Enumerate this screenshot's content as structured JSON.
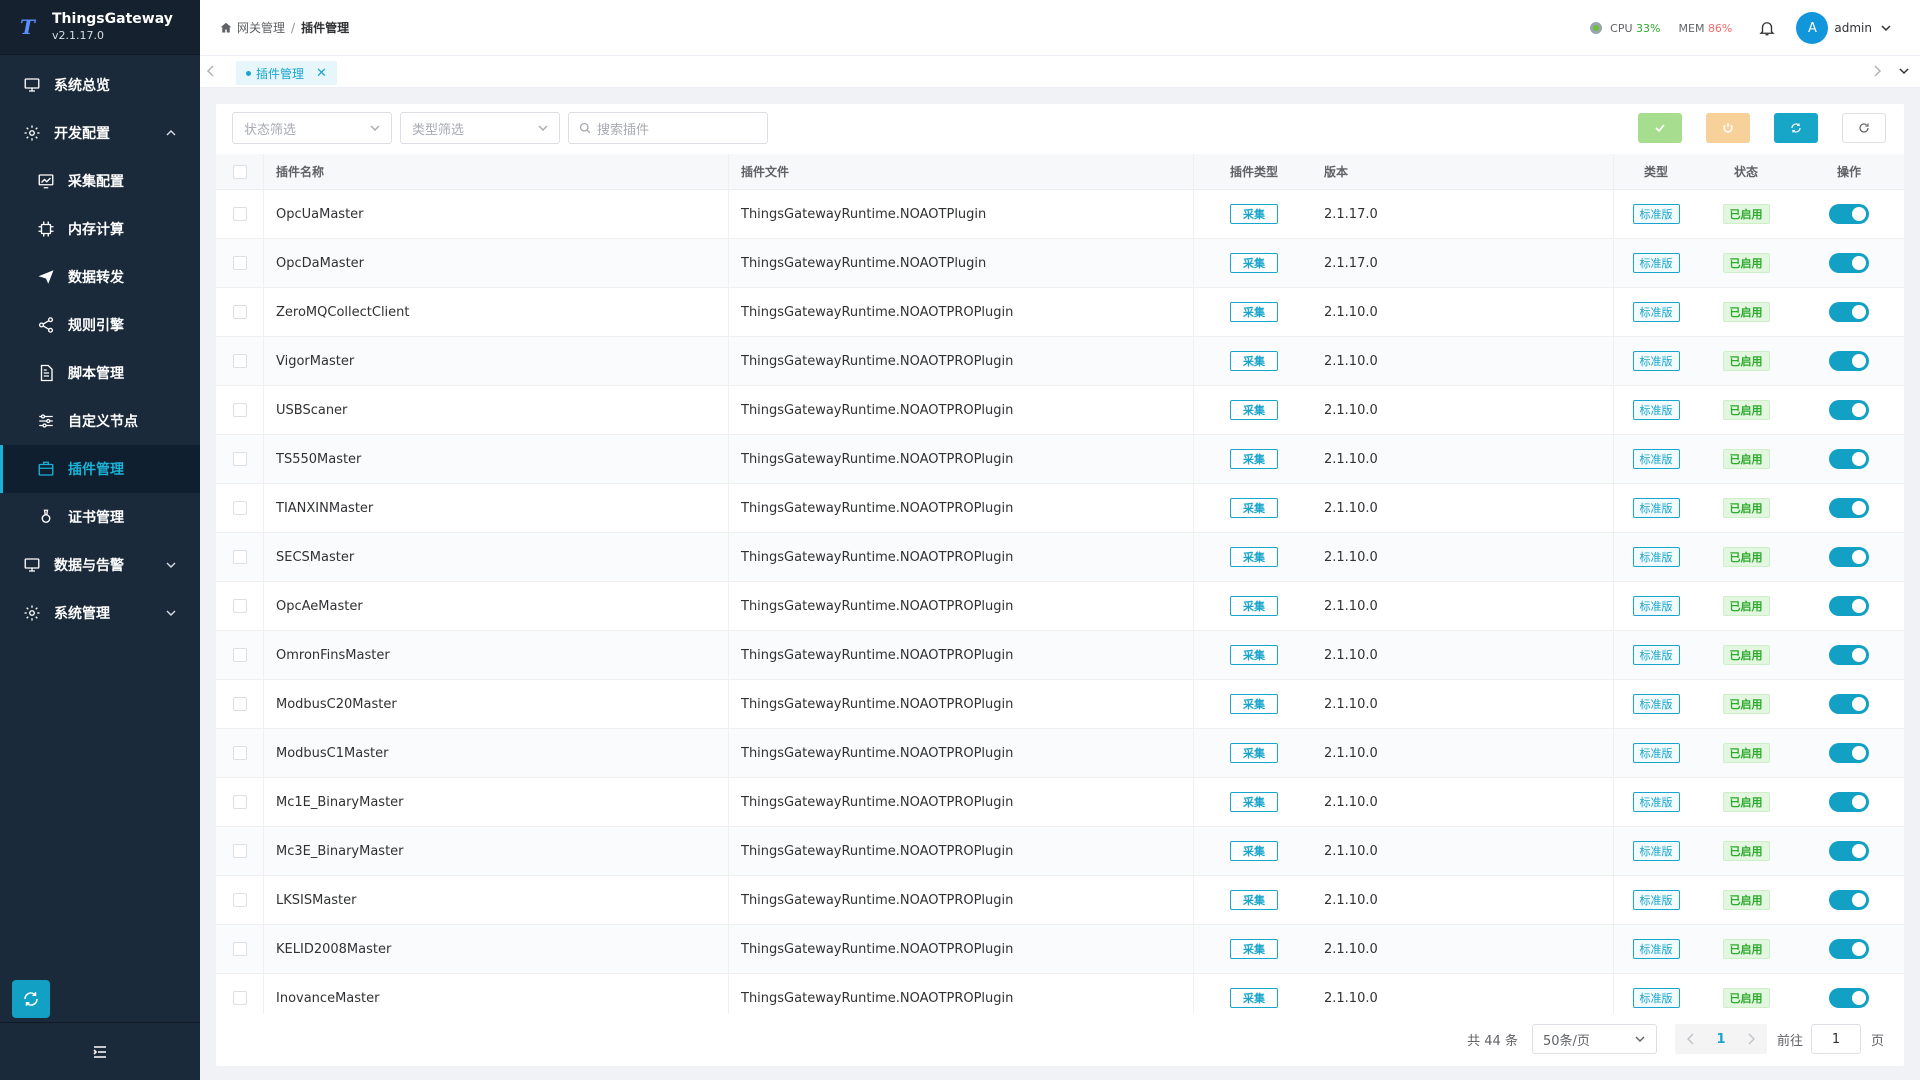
{
  "app": {
    "name": "ThingsGateway",
    "version": "v2.1.17.0",
    "logo": "T"
  },
  "sidebar": {
    "items": [
      {
        "label": "系统总览",
        "icon": "monitor-icon",
        "level": "top"
      },
      {
        "label": "开发配置",
        "icon": "gear-icon",
        "level": "top",
        "expanded": true
      },
      {
        "label": "采集配置",
        "icon": "chart-monitor-icon",
        "level": "sub"
      },
      {
        "label": "内存计算",
        "icon": "chip-icon",
        "level": "sub"
      },
      {
        "label": "数据转发",
        "icon": "send-icon",
        "level": "sub"
      },
      {
        "label": "规则引擎",
        "icon": "share-icon",
        "level": "sub"
      },
      {
        "label": "脚本管理",
        "icon": "document-icon",
        "level": "sub"
      },
      {
        "label": "自定义节点",
        "icon": "sliders-icon",
        "level": "sub"
      },
      {
        "label": "插件管理",
        "icon": "plugin-icon",
        "level": "sub",
        "active": true
      },
      {
        "label": "证书管理",
        "icon": "certificate-icon",
        "level": "sub"
      },
      {
        "label": "数据与告警",
        "icon": "monitor-icon",
        "level": "top",
        "expanded": false
      },
      {
        "label": "系统管理",
        "icon": "gear-icon",
        "level": "top",
        "expanded": false
      }
    ]
  },
  "header": {
    "breadcrumb": {
      "home": "网关管理",
      "current": "插件管理"
    },
    "cpu_label": "CPU",
    "cpu_value": "33%",
    "mem_label": "MEM",
    "mem_value": "86%",
    "avatar_letter": "A",
    "username": "admin"
  },
  "tabs": [
    {
      "label": "插件管理",
      "close": "✕"
    }
  ],
  "filters": {
    "status_placeholder": "状态筛选",
    "type_placeholder": "类型筛选",
    "search_placeholder": "搜索插件"
  },
  "table": {
    "columns": {
      "name": "插件名称",
      "file": "插件文件",
      "plugin_type": "插件类型",
      "version": "版本",
      "type": "类型",
      "status": "状态",
      "op": "操作"
    },
    "rows": [
      {
        "name": "OpcUaMaster",
        "file": "ThingsGatewayRuntime.NOAOTPlugin",
        "plugin_type": "采集",
        "version": "2.1.17.0",
        "type": "标准版",
        "status": "已启用",
        "enabled": true
      },
      {
        "name": "OpcDaMaster",
        "file": "ThingsGatewayRuntime.NOAOTPlugin",
        "plugin_type": "采集",
        "version": "2.1.17.0",
        "type": "标准版",
        "status": "已启用",
        "enabled": true
      },
      {
        "name": "ZeroMQCollectClient",
        "file": "ThingsGatewayRuntime.NOAOTPROPlugin",
        "plugin_type": "采集",
        "version": "2.1.10.0",
        "type": "标准版",
        "status": "已启用",
        "enabled": true
      },
      {
        "name": "VigorMaster",
        "file": "ThingsGatewayRuntime.NOAOTPROPlugin",
        "plugin_type": "采集",
        "version": "2.1.10.0",
        "type": "标准版",
        "status": "已启用",
        "enabled": true
      },
      {
        "name": "USBScaner",
        "file": "ThingsGatewayRuntime.NOAOTPROPlugin",
        "plugin_type": "采集",
        "version": "2.1.10.0",
        "type": "标准版",
        "status": "已启用",
        "enabled": true
      },
      {
        "name": "TS550Master",
        "file": "ThingsGatewayRuntime.NOAOTPROPlugin",
        "plugin_type": "采集",
        "version": "2.1.10.0",
        "type": "标准版",
        "status": "已启用",
        "enabled": true
      },
      {
        "name": "TIANXINMaster",
        "file": "ThingsGatewayRuntime.NOAOTPROPlugin",
        "plugin_type": "采集",
        "version": "2.1.10.0",
        "type": "标准版",
        "status": "已启用",
        "enabled": true
      },
      {
        "name": "SECSMaster",
        "file": "ThingsGatewayRuntime.NOAOTPROPlugin",
        "plugin_type": "采集",
        "version": "2.1.10.0",
        "type": "标准版",
        "status": "已启用",
        "enabled": true
      },
      {
        "name": "OpcAeMaster",
        "file": "ThingsGatewayRuntime.NOAOTPROPlugin",
        "plugin_type": "采集",
        "version": "2.1.10.0",
        "type": "标准版",
        "status": "已启用",
        "enabled": true
      },
      {
        "name": "OmronFinsMaster",
        "file": "ThingsGatewayRuntime.NOAOTPROPlugin",
        "plugin_type": "采集",
        "version": "2.1.10.0",
        "type": "标准版",
        "status": "已启用",
        "enabled": true
      },
      {
        "name": "ModbusC20Master",
        "file": "ThingsGatewayRuntime.NOAOTPROPlugin",
        "plugin_type": "采集",
        "version": "2.1.10.0",
        "type": "标准版",
        "status": "已启用",
        "enabled": true
      },
      {
        "name": "ModbusC1Master",
        "file": "ThingsGatewayRuntime.NOAOTPROPlugin",
        "plugin_type": "采集",
        "version": "2.1.10.0",
        "type": "标准版",
        "status": "已启用",
        "enabled": true
      },
      {
        "name": "Mc1E_BinaryMaster",
        "file": "ThingsGatewayRuntime.NOAOTPROPlugin",
        "plugin_type": "采集",
        "version": "2.1.10.0",
        "type": "标准版",
        "status": "已启用",
        "enabled": true
      },
      {
        "name": "Mc3E_BinaryMaster",
        "file": "ThingsGatewayRuntime.NOAOTPROPlugin",
        "plugin_type": "采集",
        "version": "2.1.10.0",
        "type": "标准版",
        "status": "已启用",
        "enabled": true
      },
      {
        "name": "LKSISMaster",
        "file": "ThingsGatewayRuntime.NOAOTPROPlugin",
        "plugin_type": "采集",
        "version": "2.1.10.0",
        "type": "标准版",
        "status": "已启用",
        "enabled": true
      },
      {
        "name": "KELID2008Master",
        "file": "ThingsGatewayRuntime.NOAOTPROPlugin",
        "plugin_type": "采集",
        "version": "2.1.10.0",
        "type": "标准版",
        "status": "已启用",
        "enabled": true
      },
      {
        "name": "InovanceMaster",
        "file": "ThingsGatewayRuntime.NOAOTPROPlugin",
        "plugin_type": "采集",
        "version": "2.1.10.0",
        "type": "标准版",
        "status": "已启用",
        "enabled": true
      }
    ]
  },
  "pagination": {
    "total_text": "共 44 条",
    "page_size": "50条/页",
    "current_page": "1",
    "goto_label": "前往",
    "goto_value": "1",
    "page_unit": "页"
  },
  "colors": {
    "accent": "#12a1c4",
    "sidebar_bg": "#1b2a3b",
    "success": "#2eaa2e",
    "danger": "#f56c6c"
  }
}
